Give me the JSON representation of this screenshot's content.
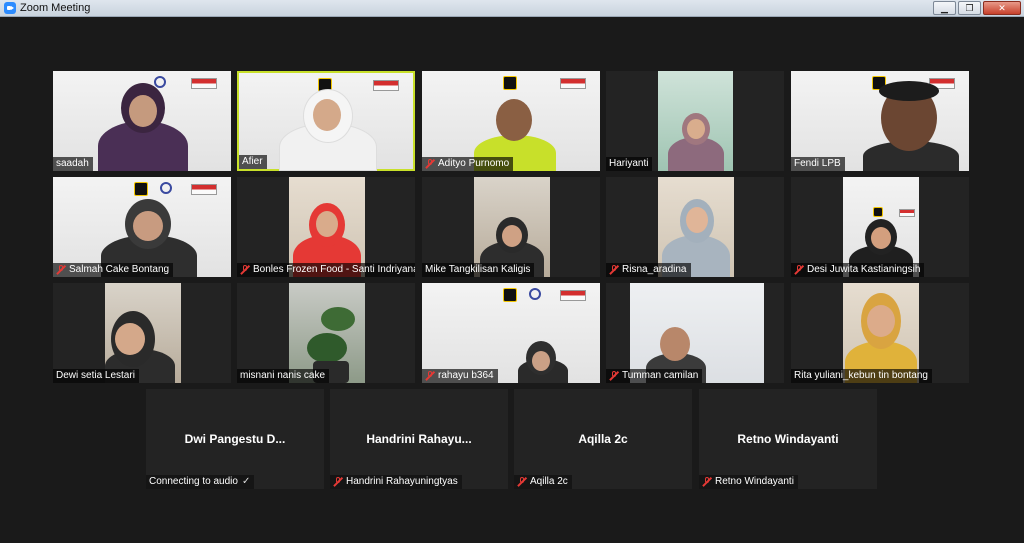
{
  "window": {
    "title": "Zoom Meeting",
    "controls": [
      "minimize",
      "restore",
      "close"
    ]
  },
  "colors": {
    "active_speaker": "#c8e02a",
    "muted": "#e53935",
    "stage_bg": "#1a1a1a",
    "tile_bg": "#232323"
  },
  "video_tiles": [
    {
      "name": "saadah",
      "muted": false,
      "active": false
    },
    {
      "name": "Afier",
      "muted": false,
      "active": true
    },
    {
      "name": "Adityo Purnomo",
      "muted": true,
      "active": false
    },
    {
      "name": "Hariyanti",
      "muted": false,
      "active": false
    },
    {
      "name": "Fendi LPB",
      "muted": false,
      "active": false
    },
    {
      "name": "Salmah Cake Bontang",
      "muted": true,
      "active": false
    },
    {
      "name": "Bonles Frozen Food - Santi Indriyana",
      "muted": true,
      "active": false
    },
    {
      "name": "Mike Tangkilisan Kaligis",
      "muted": false,
      "active": false
    },
    {
      "name": "Risna_aradina",
      "muted": true,
      "active": false
    },
    {
      "name": "Desi Juwita Kastianingsih",
      "muted": true,
      "active": false
    },
    {
      "name": "Dewi setia Lestari",
      "muted": false,
      "active": false
    },
    {
      "name": "misnani nanis cake",
      "muted": false,
      "active": false
    },
    {
      "name": "rahayu b364",
      "muted": true,
      "active": false
    },
    {
      "name": "Tumman camilan",
      "muted": true,
      "active": false
    },
    {
      "name": "Rita yuliani_kebun tin bontang",
      "muted": false,
      "active": false
    }
  ],
  "name_cards": [
    {
      "display": "Dwi Pangestu D...",
      "tag": "Connecting to audio",
      "muted": false,
      "connecting": true
    },
    {
      "display": "Handrini  Rahayu...",
      "tag": "Handrini Rahayuningtyas",
      "muted": true,
      "connecting": false
    },
    {
      "display": "Aqilla 2c",
      "tag": "Aqilla 2c",
      "muted": true,
      "connecting": false
    },
    {
      "display": "Retno Windayanti",
      "tag": "Retno Windayanti",
      "muted": true,
      "connecting": false
    }
  ]
}
